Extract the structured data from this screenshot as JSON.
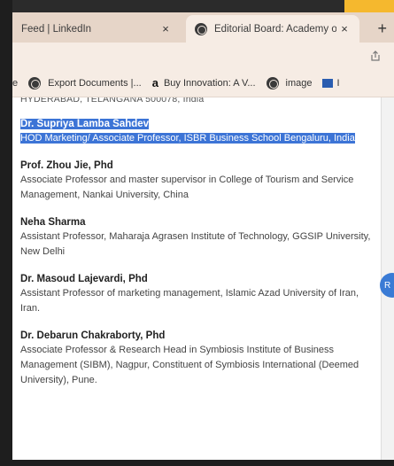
{
  "tabs": [
    {
      "title": "Feed | LinkedIn",
      "close": "×"
    },
    {
      "title": "Editorial Board: Academy o",
      "close": "×"
    }
  ],
  "new_tab": "+",
  "bookmarks": [
    {
      "label": "e",
      "icon": ""
    },
    {
      "label": "Export Documents |...",
      "icon": "globe-icon"
    },
    {
      "label": "Buy Innovation: A V...",
      "icon": "amazon-icon",
      "icon_text": "a"
    },
    {
      "label": "image",
      "icon": "globe-icon"
    },
    {
      "label": "I",
      "icon": "bookmark-square-icon"
    }
  ],
  "content": {
    "cut_line": "HYDERABAD, TELANGANA 500078, India",
    "entries": [
      {
        "name": "Dr. Supriya Lamba Sahdev",
        "desc": "HOD Marketing/ Associate Professor, ISBR Business School Bengaluru, India",
        "highlighted": true
      },
      {
        "name": "Prof. Zhou Jie, Phd",
        "desc": "Associate Professor and master supervisor in College of Tourism and Service Management, Nankai University, China"
      },
      {
        "name": "Neha Sharma",
        "desc": "Assistant Professor, Maharaja Agrasen Institute of Technology, GGSIP University, New Delhi"
      },
      {
        "name": "Dr. Masoud Lajevardi, Phd",
        "desc": "Assistant Professor of marketing management, Islamic Azad University of Iran, Iran."
      },
      {
        "name": "Dr. Debarun Chakraborty, Phd",
        "desc": "Associate Professor & Research Head in Symbiosis Institute of Business Management (SIBM), Nagpur, Constituent of Symbiosis International (Deemed University), Pune."
      }
    ]
  },
  "floating_button": "R",
  "colors": {
    "highlight": "#3c74d6",
    "tabbar": "#e6d5c8",
    "toolbar": "#f6ece4",
    "accent": "#f5b82e"
  }
}
